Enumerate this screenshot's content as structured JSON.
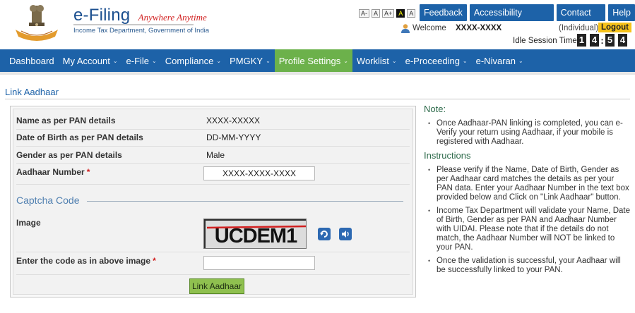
{
  "header": {
    "brand_title": "e-Filing",
    "brand_tagline": "Anywhere Anytime",
    "brand_subtitle": "Income Tax Department, Government of India",
    "font_buttons": [
      "A-",
      "A",
      "A+",
      "A",
      "A"
    ],
    "top_links": [
      "Feedback",
      "Accessibility Options",
      "Contact Us",
      "Help"
    ],
    "welcome": "Welcome",
    "username": "XXXX-XXXX",
    "user_type": "(Individual)",
    "logout": "Logout",
    "idle_label": "Idle Session Timer",
    "timer_digits": [
      "1",
      "4",
      "5",
      "4"
    ],
    "timer_separator": ":"
  },
  "nav": {
    "items": [
      {
        "label": "Dashboard",
        "has_caret": false
      },
      {
        "label": "My Account",
        "has_caret": true
      },
      {
        "label": "e-File",
        "has_caret": true
      },
      {
        "label": "Compliance",
        "has_caret": true
      },
      {
        "label": "PMGKY",
        "has_caret": true
      },
      {
        "label": "Profile Settings",
        "has_caret": true,
        "active": true
      },
      {
        "label": "Worklist",
        "has_caret": true
      },
      {
        "label": "e-Proceeding",
        "has_caret": true
      },
      {
        "label": "e-Nivaran",
        "has_caret": true
      }
    ],
    "caret": "⌄"
  },
  "page": {
    "title": "Link Aadhaar"
  },
  "form": {
    "name_label": "Name as per PAN details",
    "name_value": "XXXX-XXXXX",
    "dob_label": "Date of Birth as per PAN details",
    "dob_value": "DD-MM-YYYY",
    "gender_label": "Gender as per PAN details",
    "gender_value": "Male",
    "aadhaar_label": "Aadhaar Number",
    "aadhaar_value": "XXXX-XXXX-XXXX",
    "required_mark": "*",
    "captcha_section": "Captcha Code",
    "image_label": "Image",
    "captcha_text": "UCDEM1",
    "captcha_input_label": "Enter the code as in above image",
    "captcha_input_value": "",
    "submit_label": "Link Aadhaar"
  },
  "notes": {
    "note_heading": "Note:",
    "note_items": [
      "Once Aadhaar-PAN linking is completed, you can e-Verify your return using Aadhaar, if your mobile is registered with Aadhaar."
    ],
    "instructions_heading": "Instructions",
    "instruction_items": [
      "Please verify if the Name, Date of Birth, Gender as per Aadhaar card matches the details as per your PAN data. Enter your Aadhaar Number in the text box provided below and Click on \"Link Aadhaar\" button.",
      "Income Tax Department will validate your Name, Date of Birth, Gender as per PAN and Aadhaar Number with UIDAI. Please note that if the details do not match, the Aadhaar Number will NOT be linked to your PAN.",
      "Once the validation is successful, your Aadhaar will be successfully linked to your PAN."
    ]
  },
  "colors": {
    "primary_blue": "#1d62a8",
    "active_green": "#6cb14b",
    "logout_yellow": "#f6c219",
    "tagline_red": "#d11f1f"
  }
}
